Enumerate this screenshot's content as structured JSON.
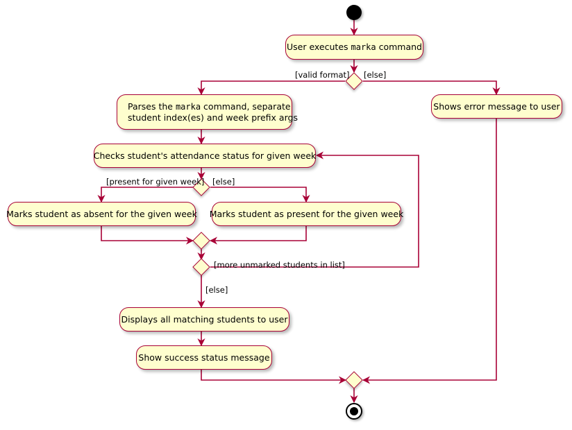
{
  "diagram": {
    "type": "uml-activity-diagram",
    "title": "marka command activity diagram",
    "colors": {
      "node_fill": "#FEFECE",
      "node_border": "#A80036",
      "edge": "#A80036",
      "text": "#000000",
      "background": "#FFFFFF"
    },
    "nodes": [
      {
        "id": "start",
        "kind": "initial-node",
        "label": ""
      },
      {
        "id": "a1",
        "kind": "activity",
        "label_pre": "User executes ",
        "label_mono": "marka",
        "label_post": " command"
      },
      {
        "id": "d1",
        "kind": "decision",
        "label": ""
      },
      {
        "id": "a2",
        "kind": "activity",
        "line1_pre": "Parses the ",
        "line1_mono": "marka",
        "line1_post": " command, separate",
        "line2": "student index(es) and week prefix args"
      },
      {
        "id": "a3",
        "kind": "activity",
        "label": "Checks student's attendance status for given week"
      },
      {
        "id": "d2",
        "kind": "decision",
        "label": ""
      },
      {
        "id": "a4",
        "kind": "activity",
        "label": "Marks student as absent for the given week"
      },
      {
        "id": "a5",
        "kind": "activity",
        "label": "Marks student as present for the given week"
      },
      {
        "id": "m1",
        "kind": "merge",
        "label": ""
      },
      {
        "id": "d3",
        "kind": "decision",
        "label": ""
      },
      {
        "id": "a6",
        "kind": "activity",
        "label": "Displays all matching students to user"
      },
      {
        "id": "a7",
        "kind": "activity",
        "label": "Show success status message"
      },
      {
        "id": "a8",
        "kind": "activity",
        "label": "Shows error message to user"
      },
      {
        "id": "m2",
        "kind": "merge",
        "label": ""
      },
      {
        "id": "end",
        "kind": "final-node",
        "label": ""
      }
    ],
    "edge_labels": {
      "valid_format": "[valid format]",
      "else_top": "[else]",
      "present_for_given_week": "[present for given week]",
      "else_mid": "[else]",
      "more_unmarked": "[more unmarked students in list]",
      "else_loop": "[else]"
    }
  }
}
